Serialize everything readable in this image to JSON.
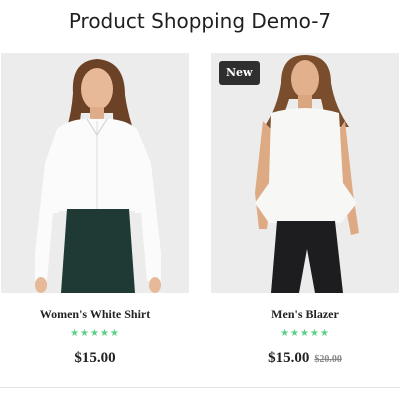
{
  "page": {
    "title": "Product Shopping Demo-7"
  },
  "products": [
    {
      "name": "Women's White Shirt",
      "badge": "",
      "rating": 5,
      "stars": "★★★★★",
      "price": "$15.00",
      "old_price": ""
    },
    {
      "name": "Men's Blazer",
      "badge": "New",
      "rating": 5,
      "stars": "★★★★★",
      "price": "$15.00",
      "old_price": "$20.00"
    }
  ],
  "colors": {
    "star": "#5cd085",
    "badge_bg": "#2f2f2f",
    "photo_bg": "#ececec"
  }
}
